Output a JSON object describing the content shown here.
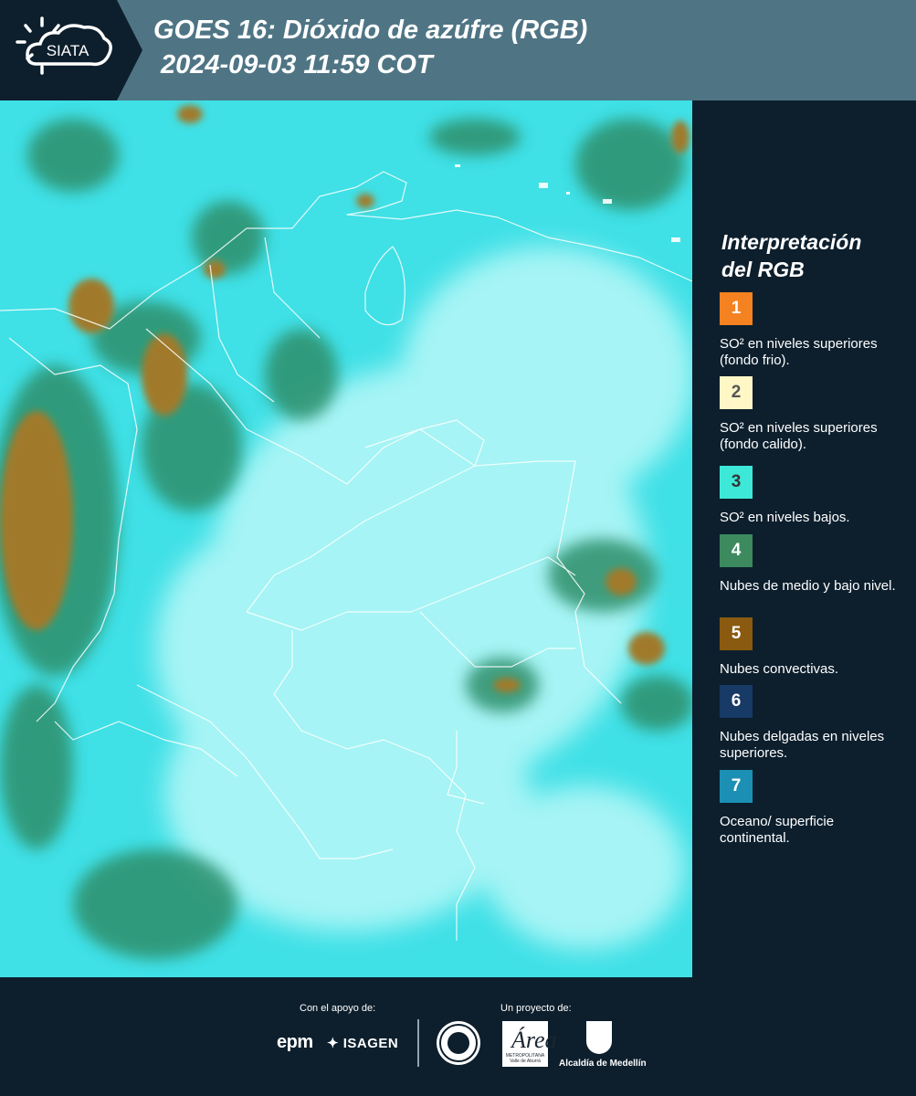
{
  "header": {
    "logo_text": "SIATA",
    "title_line1": "GOES 16: Dióxido de azúfre (RGB)",
    "title_line2": "2024-09-03 11:59 COT"
  },
  "legend": {
    "title_line1": "Interpretación",
    "title_line2": "del RGB",
    "items": [
      {
        "number": "1",
        "color": "#f58220",
        "number_color": "#ffffff",
        "label": "SO² en niveles superiores (fondo frio)."
      },
      {
        "number": "2",
        "color": "#fff8c6",
        "number_color": "#555555",
        "label": "SO² en niveles superiores (fondo calido)."
      },
      {
        "number": "3",
        "color": "#3ee8d8",
        "number_color": "#333333",
        "label": "SO² en niveles bajos."
      },
      {
        "number": "4",
        "color": "#3c8a5e",
        "number_color": "#ffffff",
        "label": "Nubes de medio y bajo nivel."
      },
      {
        "number": "5",
        "color": "#8a5a10",
        "number_color": "#ffffff",
        "label": "Nubes convectivas."
      },
      {
        "number": "6",
        "color": "#173a66",
        "number_color": "#ffffff",
        "label": "Nubes delgadas en niveles superiores."
      },
      {
        "number": "7",
        "color": "#1c8fb5",
        "number_color": "#ffffff",
        "label": "Oceano/ superficie continental."
      }
    ]
  },
  "footer": {
    "support_label": "Con el apoyo de:",
    "project_label": "Un proyecto de:",
    "sponsor1": "epm",
    "sponsor2": "ISAGEN",
    "area_logo_text": "Área",
    "area_logo_sub": "METROPOLITANA Valle de Aburrá",
    "alcaldia": "Alcaldía de Medellín"
  },
  "colors": {
    "header_bg": "#4f7585",
    "panel_bg": "#0d1f2d",
    "map_base": "#3fe0e6",
    "map_land": "#aef7f7",
    "cloud_green": "#2f8f6a",
    "cloud_brown": "#a07a2a"
  }
}
